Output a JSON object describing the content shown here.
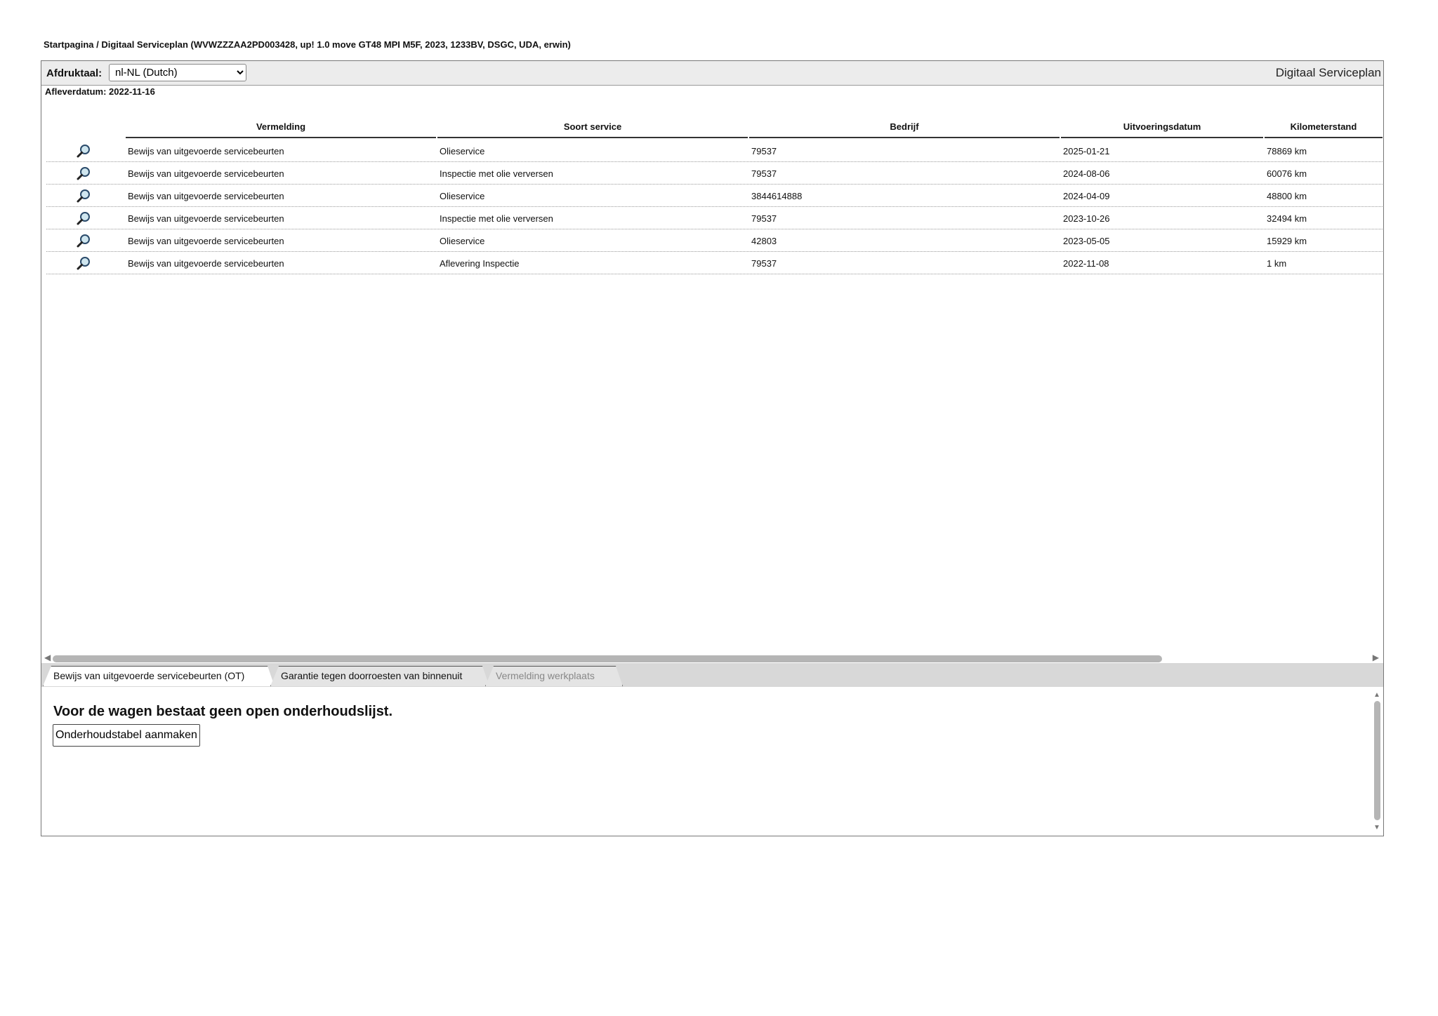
{
  "breadcrumb": "Startpagina / Digitaal Serviceplan (WVWZZZAA2PD003428, up! 1.0 move GT48 MPI M5F, 2023, 1233BV, DSGC, UDA, erwin)",
  "toolbar": {
    "language_label": "Afdruktaal:",
    "language_selected": "nl-NL (Dutch)",
    "title": "Digitaal Serviceplan"
  },
  "delivery_date": "Afleverdatum: 2022-11-16",
  "table": {
    "columns": [
      "Vermelding",
      "Soort service",
      "Bedrijf",
      "Uitvoeringsdatum",
      "Kilometerstand"
    ],
    "rows": [
      {
        "entry": "Bewijs van uitgevoerde servicebeurten",
        "service": "Olieservice",
        "company": "79537",
        "date": "2025-01-21",
        "km": "78869 km"
      },
      {
        "entry": "Bewijs van uitgevoerde servicebeurten",
        "service": "Inspectie met olie verversen",
        "company": "79537",
        "date": "2024-08-06",
        "km": "60076 km"
      },
      {
        "entry": "Bewijs van uitgevoerde servicebeurten",
        "service": "Olieservice",
        "company": "3844614888",
        "date": "2024-04-09",
        "km": "48800 km"
      },
      {
        "entry": "Bewijs van uitgevoerde servicebeurten",
        "service": "Inspectie met olie verversen",
        "company": "79537",
        "date": "2023-10-26",
        "km": "32494 km"
      },
      {
        "entry": "Bewijs van uitgevoerde servicebeurten",
        "service": "Olieservice",
        "company": "42803",
        "date": "2023-05-05",
        "km": "15929 km"
      },
      {
        "entry": "Bewijs van uitgevoerde servicebeurten",
        "service": "Aflevering Inspectie",
        "company": "79537",
        "date": "2022-11-08",
        "km": "1 km"
      }
    ]
  },
  "tabs": [
    {
      "label": "Bewijs van uitgevoerde servicebeurten (OT)",
      "state": "active"
    },
    {
      "label": "Garantie tegen doorroesten van binnenuit",
      "state": "inactive"
    },
    {
      "label": "Vermelding werkplaats",
      "state": "disabled"
    }
  ],
  "lower": {
    "message": "Voor de wagen bestaat geen open onderhoudslijst.",
    "button_label": "Onderhoudstabel aanmaken"
  },
  "icons": {
    "view": "magnifier-icon"
  }
}
